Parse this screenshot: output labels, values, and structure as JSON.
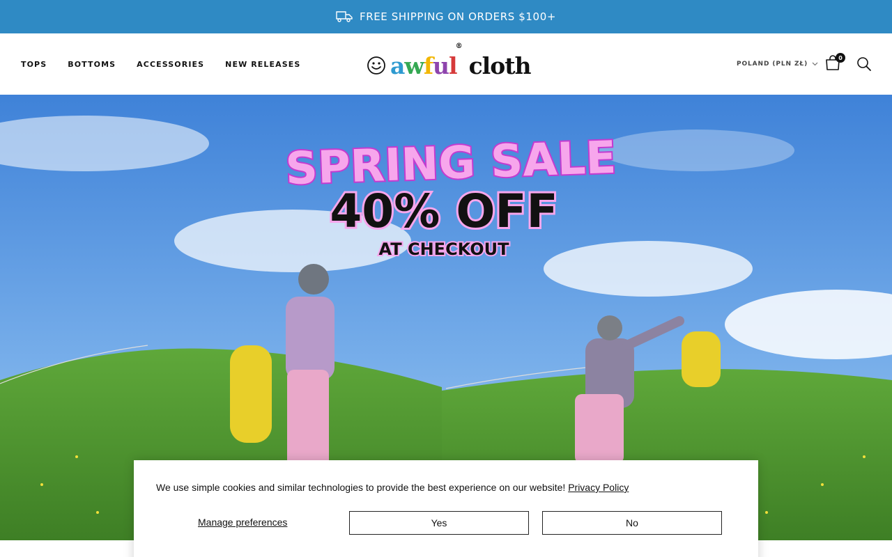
{
  "announcement": {
    "text": "FREE SHIPPING ON ORDERS $100+",
    "icon": "truck-icon"
  },
  "nav": {
    "items": [
      {
        "label": "TOPS"
      },
      {
        "label": "BOTTOMS"
      },
      {
        "label": "ACCESSORIES"
      },
      {
        "label": "NEW RELEASES"
      }
    ]
  },
  "logo": {
    "letters": [
      "a",
      "w",
      "f",
      "u",
      "l"
    ],
    "letter_colors": [
      "#2e9ad0",
      "#35a853",
      "#f2b705",
      "#8e44ad",
      "#d63a3a"
    ],
    "second_word": "cloth",
    "mark": "®"
  },
  "header": {
    "locale": "POLAND (PLN ZŁ)",
    "cart_count": "0"
  },
  "hero": {
    "headline_top": "SPRING SALE",
    "headline_main": "40% OFF",
    "headline_bottom": "AT CHECKOUT"
  },
  "cookie": {
    "message": "We use simple cookies and similar technologies to provide the best experience on our website!",
    "policy_link": "Privacy Policy",
    "manage": "Manage preferences",
    "yes": "Yes",
    "no": "No"
  },
  "colors": {
    "announcement_bg": "#2f8ac4",
    "sale_pink": "#f7a6ec",
    "sale_outline": "#c33bd0"
  }
}
